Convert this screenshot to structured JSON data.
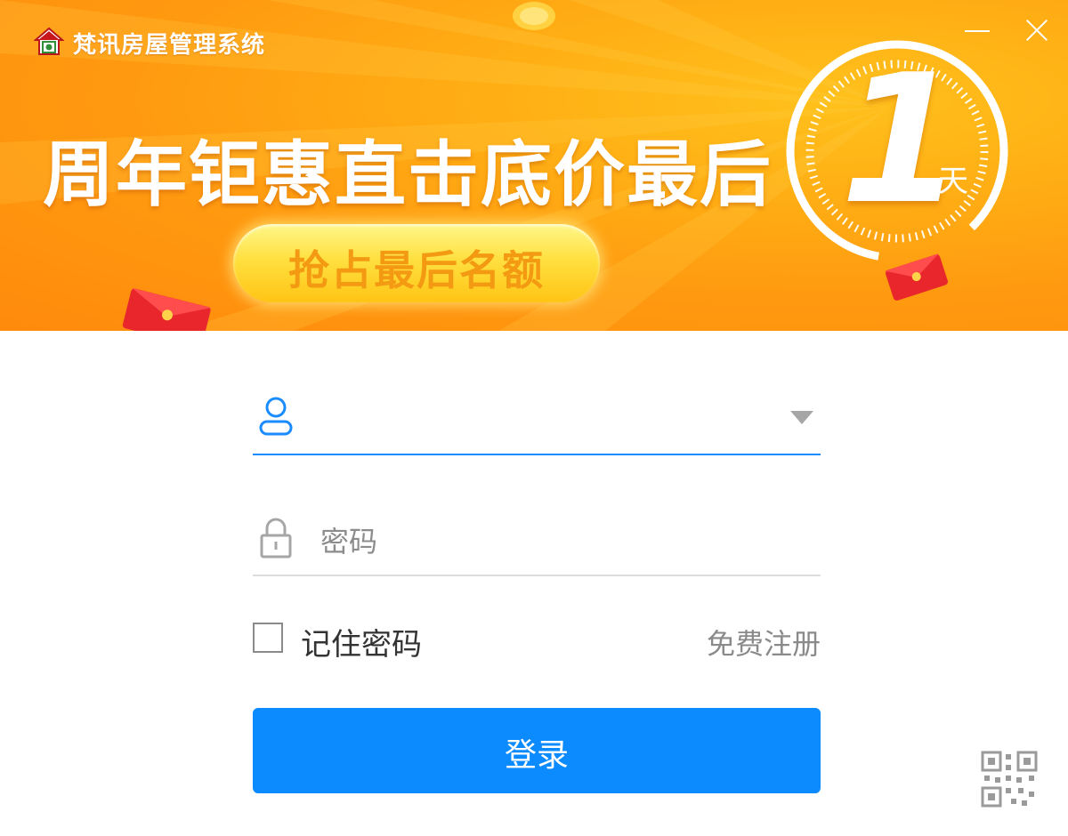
{
  "app": {
    "title": "梵讯房屋管理系统"
  },
  "banner": {
    "headline": "周年钜惠直击底价最后",
    "countdown_value": "1",
    "countdown_unit": "天",
    "cta_label": "抢占最后名额"
  },
  "login_form": {
    "username_value": "",
    "password_placeholder": "密码",
    "remember_label": "记住密码",
    "register_label": "免费注册",
    "login_button_label": "登录"
  },
  "colors": {
    "accent": "#0c8bff",
    "banner_orange": "#ff9a10",
    "cta_text": "#f39a12"
  },
  "icons": {
    "logo": "house-logo-icon",
    "username": "user-icon",
    "password": "lock-icon",
    "dropdown": "chevron-down-icon",
    "qr": "qr-code-icon"
  }
}
